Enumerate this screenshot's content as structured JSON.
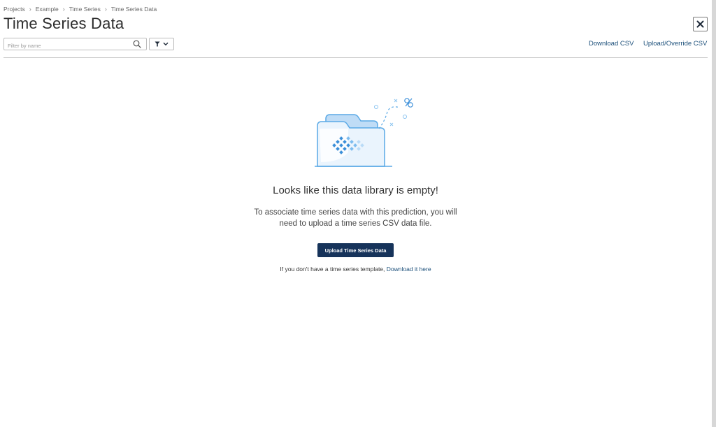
{
  "breadcrumb": [
    "Projects",
    "Example",
    "Time Series",
    "Time Series Data"
  ],
  "title": "Time Series Data",
  "filter": {
    "placeholder": "Filter by name",
    "value": ""
  },
  "actions": {
    "download_csv": "Download CSV",
    "upload_override_csv": "Upload/Override CSV"
  },
  "empty_state": {
    "heading": "Looks like this data library is empty!",
    "description_line1": "To associate time series data with this prediction, you will",
    "description_line2": "need to upload a time series CSV data file.",
    "button": "Upload Time Series Data",
    "template_text": "If you don't have a time series template,",
    "template_link": "Download it here"
  },
  "icons": {
    "close": "close-icon",
    "search": "search-icon",
    "filter": "filter-icon",
    "chevron": "chevron-down-icon",
    "breadcrumb_separator": "chevron-right-icon",
    "illustration": "empty-folder-illustration"
  },
  "colors": {
    "primary_button": "#16335a",
    "link": "#1b4f7a",
    "illustration_blue": "#5aa9e6",
    "illustration_light": "#d6eafb"
  }
}
